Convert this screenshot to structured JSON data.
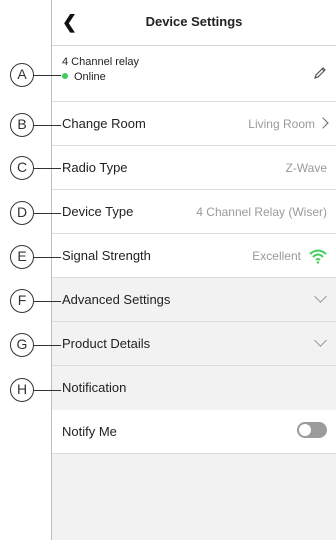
{
  "header": {
    "title": "Device Settings"
  },
  "device": {
    "name": "4 Channel relay",
    "status": "Online"
  },
  "rows": {
    "change_room": {
      "label": "Change Room",
      "value": "Living Room"
    },
    "radio_type": {
      "label": "Radio Type",
      "value": "Z-Wave"
    },
    "device_type": {
      "label": "Device Type",
      "value": "4 Channel Relay (Wiser)"
    },
    "signal_strength": {
      "label": "Signal Strength",
      "value": "Excellent"
    },
    "advanced_settings": {
      "label": "Advanced Settings"
    },
    "product_details": {
      "label": "Product Details"
    },
    "notification": {
      "label": "Notification"
    },
    "notify_me": {
      "label": "Notify Me",
      "enabled": false
    }
  },
  "callouts": [
    "A",
    "B",
    "C",
    "D",
    "E",
    "F",
    "G",
    "H"
  ],
  "colors": {
    "online": "#3dcd58",
    "signal": "#3dcd58",
    "toggle_off": "#9b9b9b"
  },
  "icons": [
    "back-chevron-icon",
    "pencil-icon",
    "chevron-right-icon",
    "wifi-signal-icon",
    "chevron-down-icon"
  ]
}
